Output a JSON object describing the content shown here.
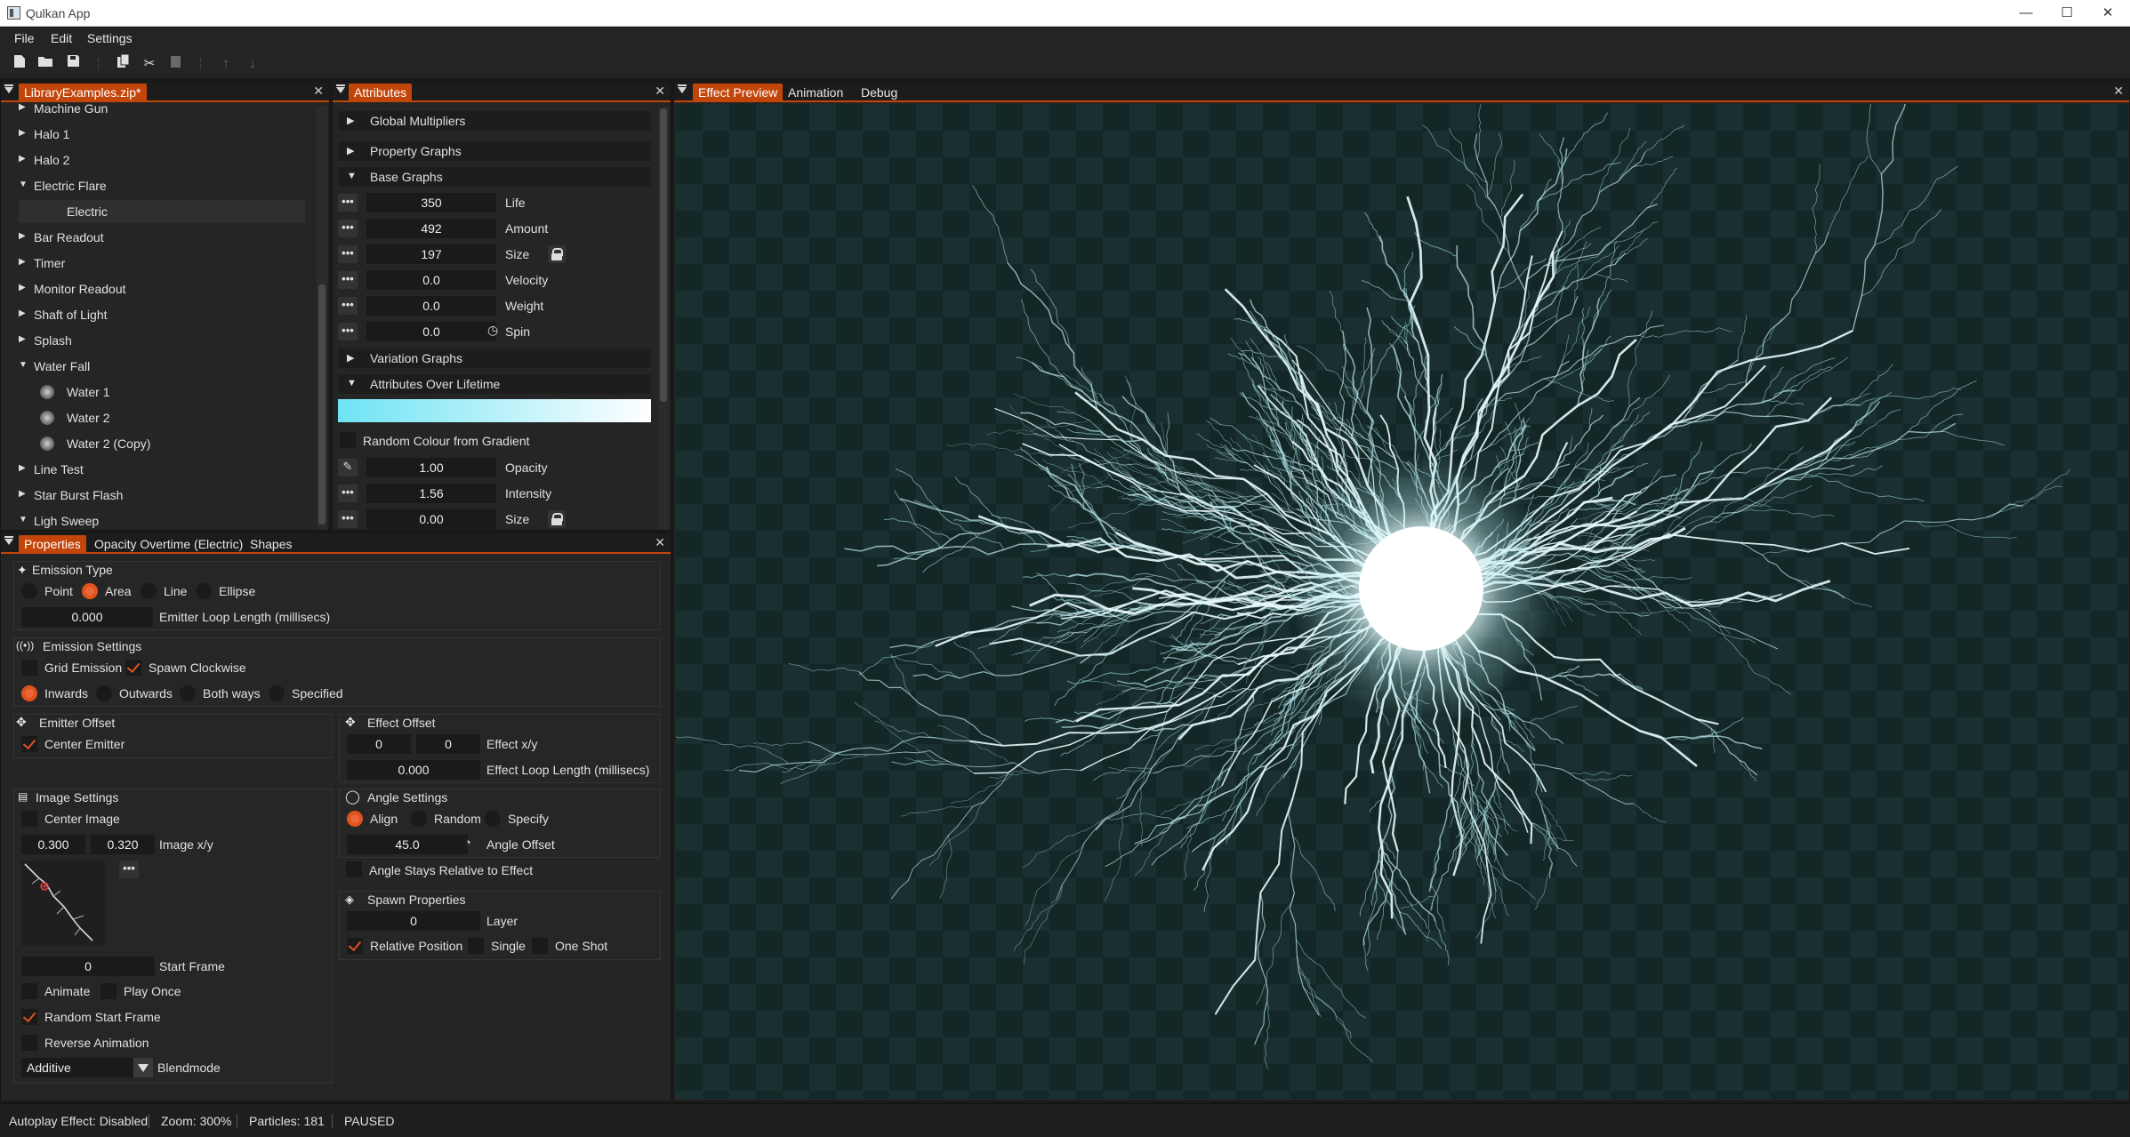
{
  "window": {
    "title": "Qulkan App",
    "minimize": "—",
    "maximize": "☐",
    "close": "✕"
  },
  "menu": [
    "File",
    "Edit",
    "Settings"
  ],
  "library": {
    "tab": "LibraryExamples.zip*",
    "close": "✕",
    "items": [
      {
        "label": "Machine Gun",
        "level": 0,
        "expanded": false
      },
      {
        "label": "Halo 1",
        "level": 0,
        "expanded": false
      },
      {
        "label": "Halo 2",
        "level": 0,
        "expanded": false
      },
      {
        "label": "Electric Flare",
        "level": 0,
        "expanded": true
      },
      {
        "label": "Electric",
        "level": 1,
        "selected": true
      },
      {
        "label": "Bar Readout",
        "level": 0,
        "expanded": false
      },
      {
        "label": "Timer",
        "level": 0,
        "expanded": false
      },
      {
        "label": "Monitor Readout",
        "level": 0,
        "expanded": false
      },
      {
        "label": "Shaft of Light",
        "level": 0,
        "expanded": false
      },
      {
        "label": "Splash",
        "level": 0,
        "expanded": false
      },
      {
        "label": "Water Fall",
        "level": 0,
        "expanded": true
      },
      {
        "label": "Water 1",
        "level": 1
      },
      {
        "label": "Water 2",
        "level": 1
      },
      {
        "label": "Water 2 (Copy)",
        "level": 1
      },
      {
        "label": "Line Test",
        "level": 0,
        "expanded": false
      },
      {
        "label": "Star Burst Flash",
        "level": 0,
        "expanded": false
      },
      {
        "label": "Ligh Sweep",
        "level": 0,
        "expanded": true
      }
    ]
  },
  "attributes": {
    "tab": "Attributes",
    "close": "✕",
    "sections": {
      "global": "Global Multipliers",
      "property": "Property Graphs",
      "base": "Base Graphs",
      "variation": "Variation Graphs",
      "lifetime": "Attributes Over Lifetime"
    },
    "base_rows": [
      {
        "value": "350",
        "label": "Life"
      },
      {
        "value": "492",
        "label": "Amount"
      },
      {
        "value": "197",
        "label": "Size"
      },
      {
        "value": "0.0",
        "label": "Velocity"
      },
      {
        "value": "0.0",
        "label": "Weight"
      },
      {
        "value": "0.0",
        "label": "Spin"
      }
    ],
    "random_colour_label": "Random Colour from Gradient",
    "lifetime_rows": [
      {
        "value": "1.00",
        "label": "Opacity"
      },
      {
        "value": "1.56",
        "label": "Intensity"
      },
      {
        "value": "0.00",
        "label": "Size"
      }
    ],
    "dots": "•••"
  },
  "properties": {
    "tabs": [
      "Properties",
      "Opacity Overtime (Electric)",
      "Shapes"
    ],
    "close": "✕",
    "emission_type": {
      "title": "Emission Type",
      "options": [
        "Point",
        "Area",
        "Line",
        "Ellipse"
      ],
      "selected": "Area",
      "loop_value": "0.000",
      "loop_label": "Emitter Loop Length (millisecs)"
    },
    "emission_settings": {
      "title": "Emission Settings",
      "grid_label": "Grid Emission",
      "spawn_label": "Spawn Clockwise",
      "directions": [
        "Inwards",
        "Outwards",
        "Both ways",
        "Specified"
      ],
      "selected": "Inwards"
    },
    "emitter_offset": {
      "title": "Emitter Offset",
      "center_label": "Center Emitter"
    },
    "effect_offset": {
      "title": "Effect Offset",
      "x": "0",
      "y": "0",
      "xy_label": "Effect x/y",
      "loop_value": "0.000",
      "loop_label": "Effect Loop Length (millisecs)"
    },
    "image_settings": {
      "title": "Image Settings",
      "center_label": "Center Image",
      "x": "0.300",
      "y": "0.320",
      "xy_label": "Image x/y",
      "start_frame": "0",
      "start_frame_label": "Start Frame",
      "animate_label": "Animate",
      "play_once_label": "Play Once",
      "random_start_label": "Random Start Frame",
      "reverse_label": "Reverse Animation",
      "blend_value": "Additive",
      "blend_label": "Blendmode"
    },
    "angle_settings": {
      "title": "Angle Settings",
      "options": [
        "Align",
        "Random",
        "Specify"
      ],
      "selected": "Align",
      "offset_value": "45.0",
      "offset_label": "Angle Offset",
      "relative_label": "Angle Stays Relative to Effect"
    },
    "spawn_properties": {
      "title": "Spawn Properties",
      "layer_value": "0",
      "layer_label": "Layer",
      "relative_label": "Relative Position",
      "single_label": "Single",
      "oneshot_label": "One Shot"
    }
  },
  "preview": {
    "tabs": [
      "Effect Preview",
      "Animation",
      "Debug"
    ],
    "close": "✕"
  },
  "status": {
    "autoplay": "Autoplay Effect: Disabled",
    "zoom": "Zoom: 300%",
    "particles": "Particles: 181",
    "state": "PAUSED"
  },
  "colors": {
    "accent": "#c2450a",
    "radio_on": "#e0531d",
    "gradient_start": "#6fe3f3",
    "gradient_end": "#ffffff"
  }
}
